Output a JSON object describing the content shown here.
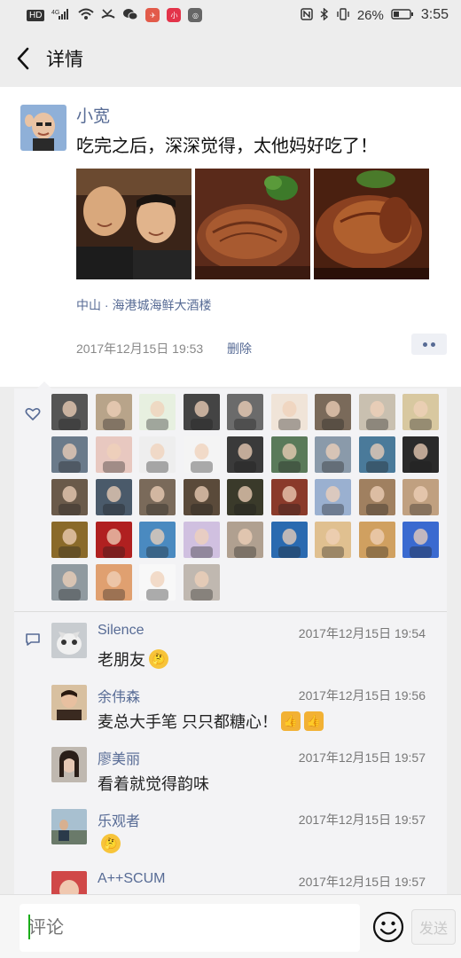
{
  "status_bar": {
    "chip": "HD",
    "network": "4G",
    "battery": "26%",
    "time": "3:55"
  },
  "header": {
    "title": "详情"
  },
  "post": {
    "author": "小宽",
    "text": "吃完之后，深深觉得，太他妈好吃了！",
    "location": "中山 · 海港城海鲜大酒楼",
    "time": "2017年12月15日 19:53",
    "delete_label": "删除"
  },
  "likes": {
    "count": 40,
    "colors": [
      "#555",
      "#b8a48a",
      "#e7f0e0",
      "#444",
      "#6b6b6b",
      "#f0e4d8",
      "#7a6a5a",
      "#c9c0b0",
      "#d8c8a0",
      "#6a7a8a",
      "#e8c8c0",
      "#eeeeee",
      "#f4f4f4",
      "#3a3a3a",
      "#5a7a5a",
      "#8a9aaa",
      "#4a7a9a",
      "#2a2a2a",
      "#6a5a4a",
      "#4a5a6a",
      "#7a6a5a",
      "#5a4a3a",
      "#3a3a2a",
      "#8a3a2a",
      "#9ab0d0",
      "#a08060",
      "#c0a080",
      "#8a6a2a",
      "#b02020",
      "#4a8ac0",
      "#d0c0e0",
      "#b0a090",
      "#2a6ab0",
      "#e0c090",
      "#d0a060",
      "#3a6ad0",
      "#909aa0",
      "#e0a070",
      "#f8f8f8",
      "#c0b8b0",
      "#7a7a7a"
    ]
  },
  "comments": [
    {
      "name": "Silence",
      "time": "2017年12月15日 19:54",
      "text": "老朋友",
      "emoji": "thinking",
      "avatar_color": "#9aa0a8"
    },
    {
      "name": "余伟森",
      "time": "2017年12月15日 19:56",
      "text": "麦总大手笔 只只都糖心！",
      "emoji": "thumbs",
      "avatar_color": "#5a4030"
    },
    {
      "name": "廖美丽",
      "time": "2017年12月15日 19:57",
      "text": "看着就觉得韵味",
      "emoji": "",
      "avatar_color": "#4a4040"
    },
    {
      "name": "乐观者",
      "time": "2017年12月15日 19:57",
      "text": "",
      "emoji": "thinking",
      "avatar_color": "#6a8aa0"
    },
    {
      "name": "A++SCUM",
      "time": "2017年12月15日 19:57",
      "text": "",
      "emoji": "",
      "avatar_color": "#c04040"
    }
  ],
  "input": {
    "placeholder": "评论",
    "send_label": "发送"
  }
}
